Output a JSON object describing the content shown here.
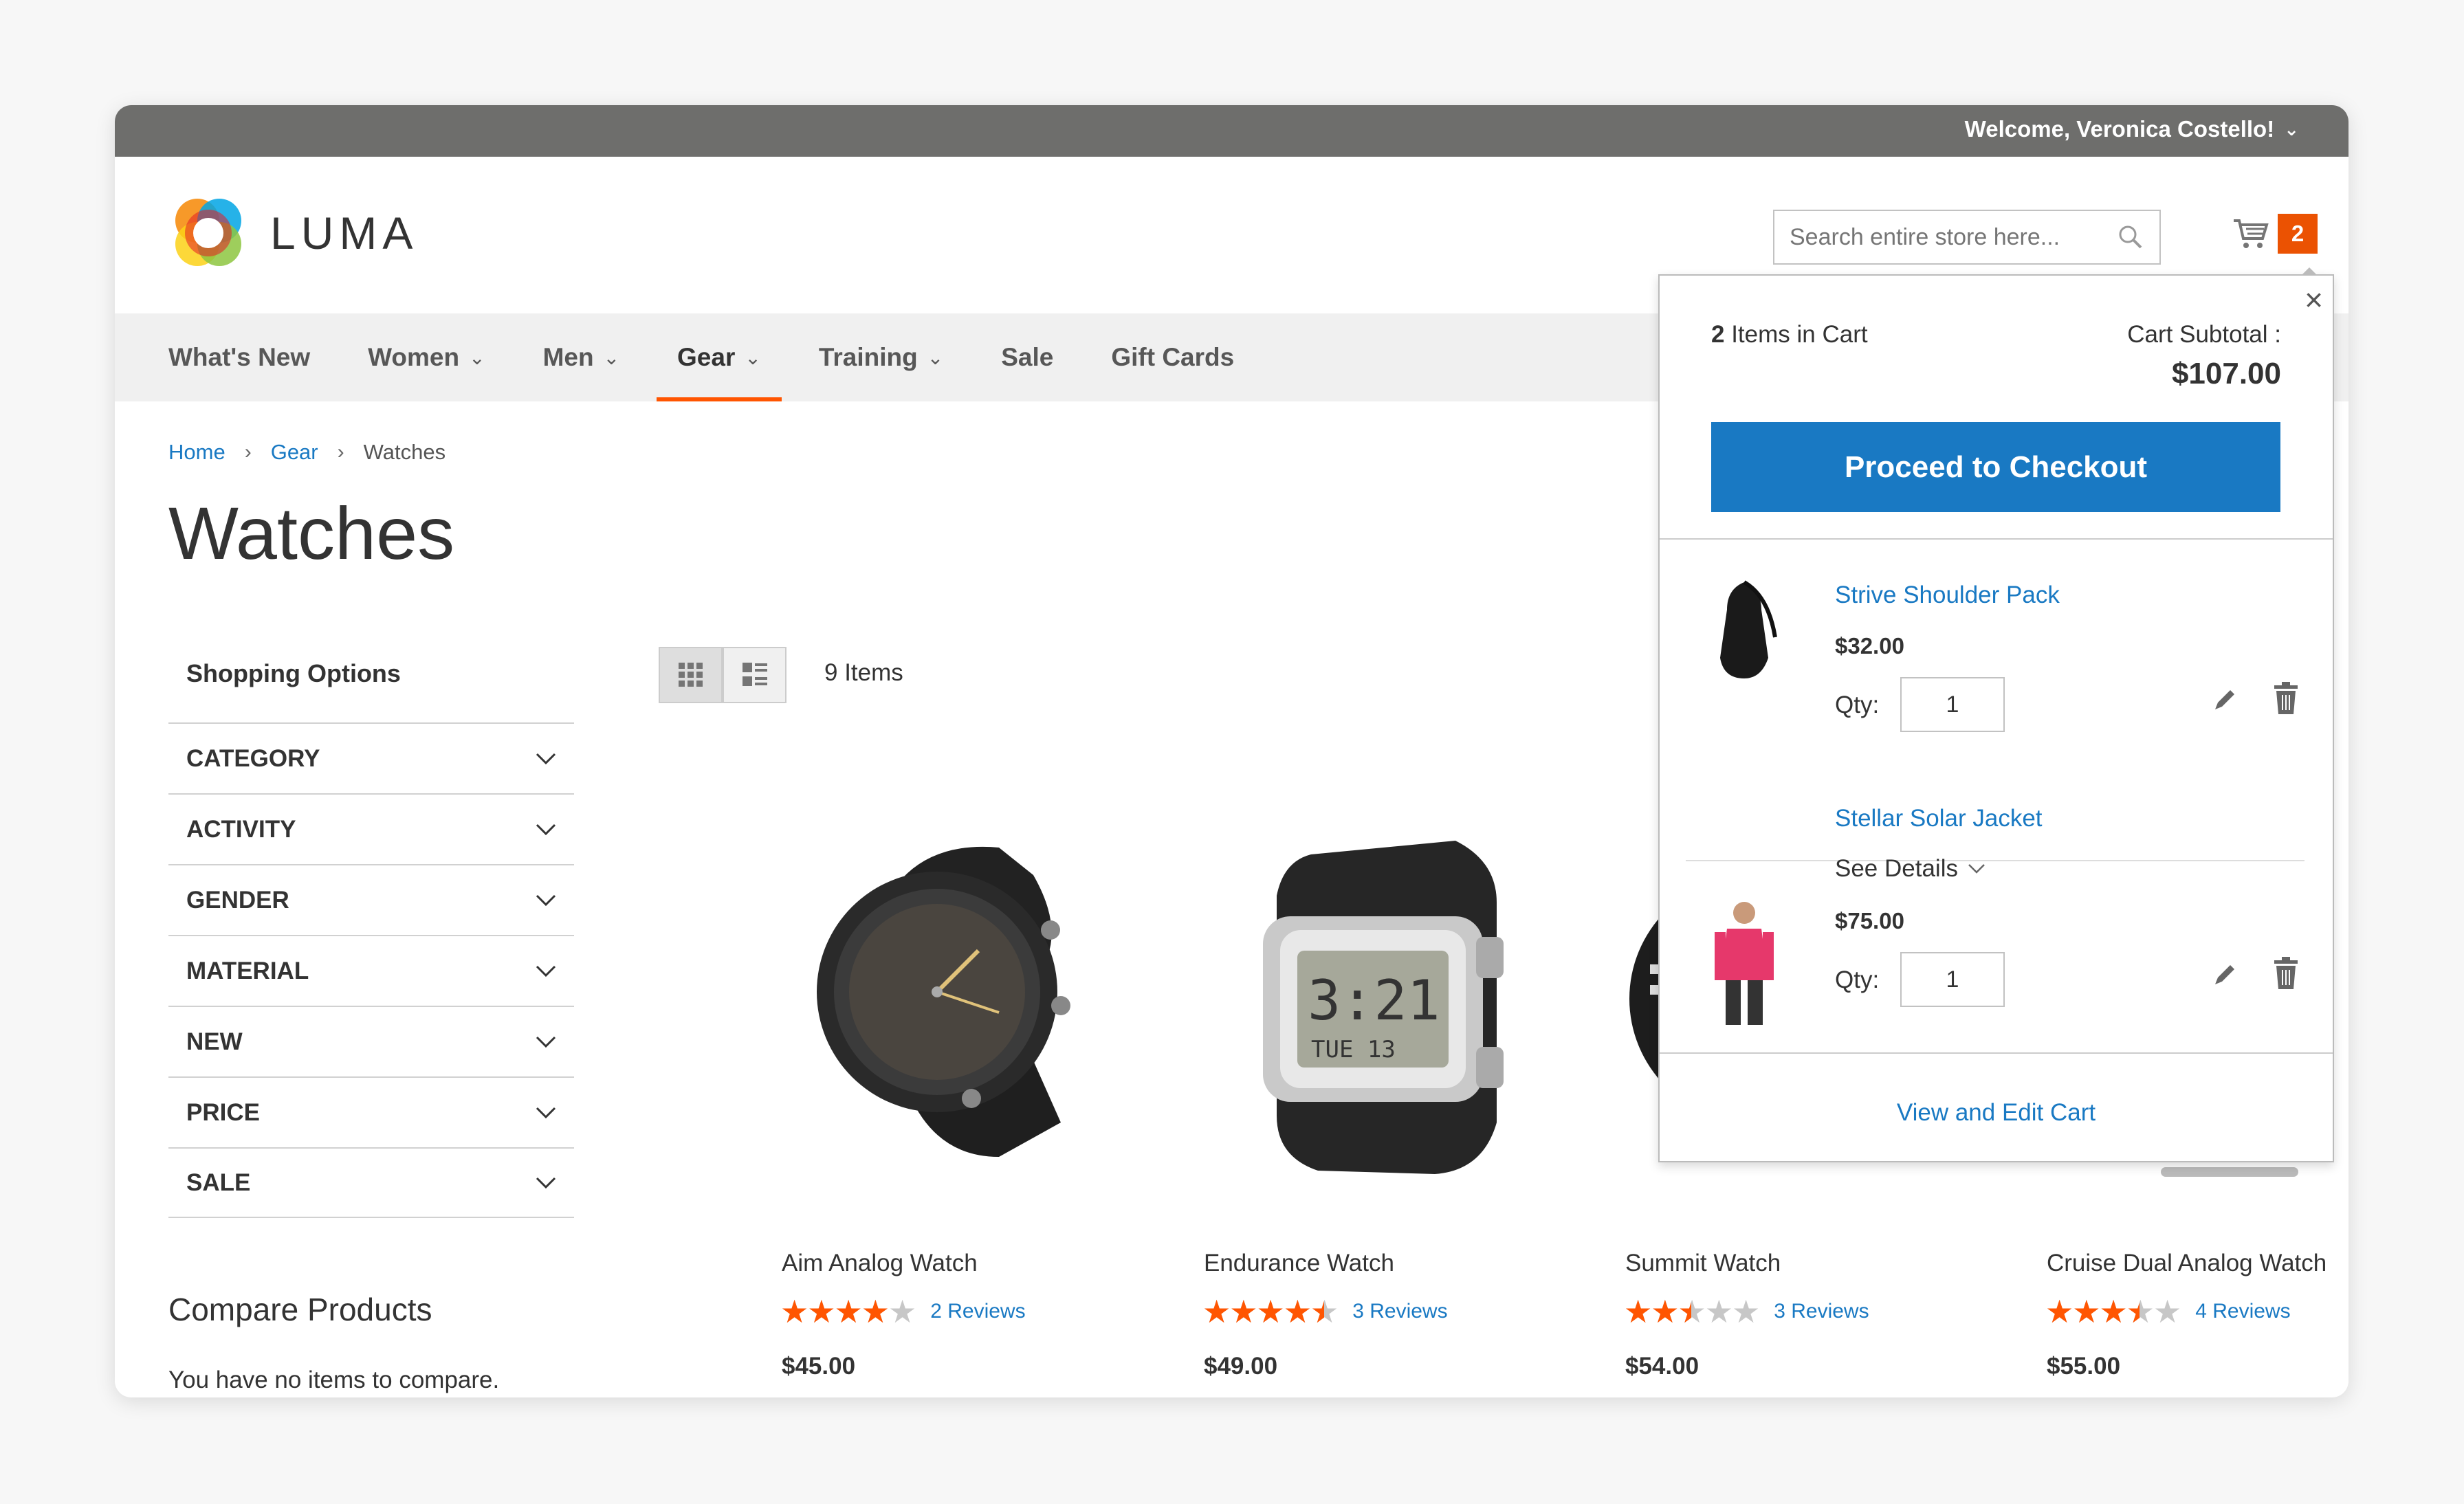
{
  "header": {
    "welcome": "Welcome, Veronica Costello!",
    "logo_text": "LUMA",
    "search_placeholder": "Search entire store here...",
    "cart_count": "2"
  },
  "nav": {
    "items": [
      {
        "label": "What's New",
        "dropdown": false
      },
      {
        "label": "Women",
        "dropdown": true
      },
      {
        "label": "Men",
        "dropdown": true
      },
      {
        "label": "Gear",
        "dropdown": true,
        "active": true
      },
      {
        "label": "Training",
        "dropdown": true
      },
      {
        "label": "Sale",
        "dropdown": false
      },
      {
        "label": "Gift Cards",
        "dropdown": false
      }
    ]
  },
  "breadcrumb": {
    "home": "Home",
    "gear": "Gear",
    "current": "Watches"
  },
  "page_title": "Watches",
  "sidebar": {
    "shopping_options": "Shopping Options",
    "filters": [
      "CATEGORY",
      "ACTIVITY",
      "GENDER",
      "MATERIAL",
      "NEW",
      "PRICE",
      "SALE"
    ],
    "compare_title": "Compare Products",
    "compare_empty": "You have no items to compare."
  },
  "toolbar": {
    "items_count": "9 Items"
  },
  "products": [
    {
      "name": "Aim Analog Watch",
      "rating": 4,
      "reviews": "2 Reviews",
      "price": "$45.00"
    },
    {
      "name": "Endurance Watch",
      "rating": 4.5,
      "reviews": "3 Reviews",
      "price": "$49.00"
    },
    {
      "name": "Summit Watch",
      "rating": 2.5,
      "reviews": "3 Reviews",
      "price": "$54.00"
    },
    {
      "name": "Cruise Dual Analog Watch",
      "rating": 3.5,
      "reviews": "4 Reviews",
      "price": "$55.00"
    }
  ],
  "minicart": {
    "items_count_number": "2",
    "items_count_text": " Items in Cart",
    "subtotal_label": "Cart Subtotal :",
    "subtotal": "$107.00",
    "checkout_label": "Proceed to Checkout",
    "items": [
      {
        "name": "Strive Shoulder Pack",
        "price": "$32.00",
        "qty_label": "Qty:",
        "qty": "1"
      },
      {
        "name": "Stellar Solar Jacket",
        "details": "See Details",
        "price": "$75.00",
        "qty_label": "Qty:",
        "qty": "1"
      }
    ],
    "view_cart": "View and Edit Cart"
  },
  "colors": {
    "accent_orange": "#ff5501",
    "link_blue": "#1979c3",
    "topbar_gray": "#6e6e6c",
    "cart_badge": "#eb5202"
  }
}
